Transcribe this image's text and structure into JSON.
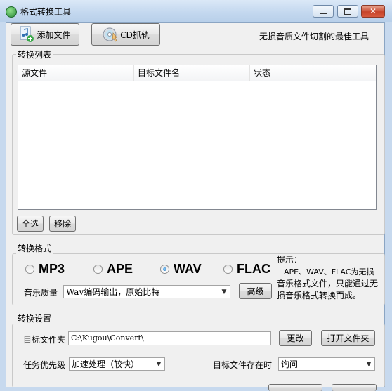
{
  "window": {
    "title": "格式转换工具"
  },
  "toolbar": {
    "add_file_label": "添加文件",
    "cd_rip_label": "CD抓轨",
    "tagline": "无损音质文件切割的最佳工具"
  },
  "convert_list": {
    "group_title": "转换列表",
    "columns": [
      "源文件",
      "目标文件名",
      "状态"
    ],
    "rows": [],
    "select_all_label": "全选",
    "remove_label": "移除"
  },
  "format": {
    "group_title": "转换格式",
    "options": [
      {
        "label": "MP3",
        "checked": false
      },
      {
        "label": "APE",
        "checked": false
      },
      {
        "label": "WAV",
        "checked": true
      },
      {
        "label": "FLAC",
        "checked": false
      }
    ],
    "quality_label": "音乐质量",
    "quality_value": "Wav编码输出，原始比特",
    "advanced_label": "高级",
    "hint_title": "提示：",
    "hint_lines": [
      "APE、WAV、FLAC为无损",
      "音乐格式文件，只能通过无",
      "损音乐格式转换而成。"
    ]
  },
  "settings": {
    "group_title": "转换设置",
    "target_folder_label": "目标文件夹",
    "target_folder_value": "C:\\Kugou\\Convert\\",
    "change_label": "更改",
    "open_folder_label": "打开文件夹",
    "priority_label": "任务优先级",
    "priority_value": "加速处理（较快）",
    "exists_label": "目标文件存在时",
    "exists_value": "询问"
  },
  "colors": {
    "title_bar": "#c4d8ef",
    "close_button": "#c7442a",
    "client_bg": "#f0f0f0"
  }
}
